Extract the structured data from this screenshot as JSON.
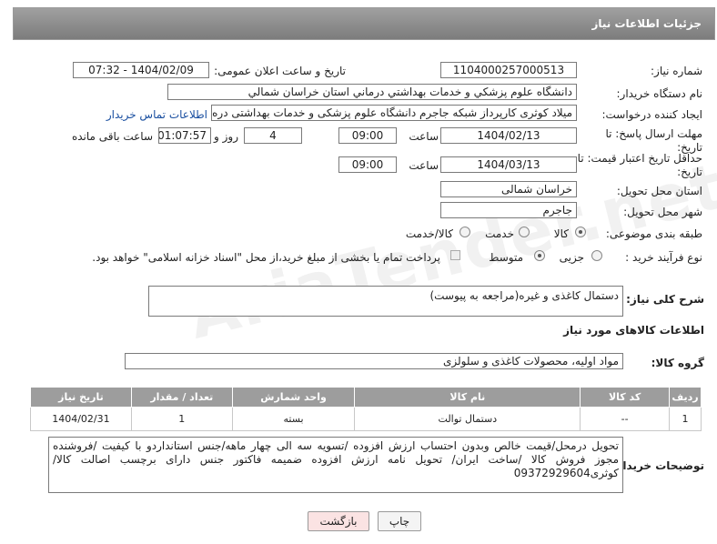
{
  "header": {
    "title": "جزئیات اطلاعات نیاز"
  },
  "fields": {
    "need_number_label": "شماره نیاز:",
    "need_number": "1104000257000513",
    "announce_label": "تاریخ و ساعت اعلان عمومی:",
    "announce_value": "1404/02/09 - 07:32",
    "buyer_org_label": "نام دستگاه خریدار:",
    "buyer_org": "دانشگاه علوم پزشکي و خدمات بهداشتي درماني استان خراسان شمالي",
    "requester_label": "ایجاد کننده درخواست:",
    "requester": "میلاد کوثری کارپرداز شبکه جاجرم دانشگاه علوم پزشکی و خدمات بهداشتی دره",
    "contact_link": "اطلاعات تماس خریدار",
    "deadline_label": "مهلت ارسال پاسخ: تا تاریخ:",
    "deadline_date": "1404/02/13",
    "time_label": "ساعت",
    "deadline_time": "09:00",
    "days_value": "4",
    "days_label": "روز و",
    "remaining_time": "01:07:57",
    "remaining_label": "ساعت باقی مانده",
    "min_validity_label": "حداقل تاریخ اعتبار قیمت: تا تاریخ:",
    "validity_date": "1404/03/13",
    "validity_time": "09:00",
    "province_label": "استان محل تحویل:",
    "province": "خراسان شمالی",
    "city_label": "شهر محل تحویل:",
    "city": "جاجرم",
    "category_label": "طبقه بندی موضوعی:",
    "category_options": [
      "کالا",
      "خدمت",
      "کالا/خدمت"
    ],
    "process_label": "نوع فرآیند خرید :",
    "process_options": [
      "جزیی",
      "متوسط"
    ],
    "payment_note": "پرداخت تمام یا بخشی از مبلغ خرید،از محل \"اسناد خزانه اسلامی\" خواهد بود."
  },
  "summary": {
    "label": "شرح کلی نیاز:",
    "text": "دستمال کاغذی و غیره(مراجعه به پیوست)"
  },
  "goods": {
    "section_title": "اطلاعات کالاهای مورد نیاز",
    "group_label": "گروه کالا:",
    "group_value": "مواد اولیه، محصولات کاغذی و سلولزی",
    "columns": [
      "ردیف",
      "کد کالا",
      "نام کالا",
      "واحد شمارش",
      "تعداد / مقدار",
      "تاریخ نیاز"
    ],
    "rows": [
      [
        "1",
        "--",
        "دستمال توالت",
        "بسته",
        "1",
        "1404/02/31"
      ]
    ]
  },
  "buyer_notes": {
    "label": "توضیحات خریدار:",
    "text": "تحویل درمحل/قیمت خالص وبدون احتساب ارزش افزوده /تسویه سه الی چهار ماهه/جنس استانداردو با کیفیت /فروشنده مجوز فروش کالا /ساخت ایران/ تحویل  نامه ارزش افزوده ضمیمه  فاکتور جنس دارای برچسب اصالت کالا/کوثری09372929604"
  },
  "buttons": {
    "print": "چاپ",
    "back": "بازگشت"
  },
  "watermark": "AriaTender.net"
}
